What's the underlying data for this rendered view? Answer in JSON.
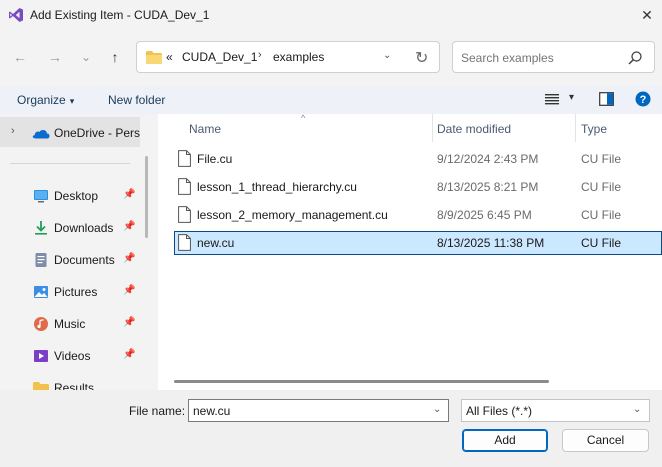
{
  "window": {
    "title": "Add Existing Item - CUDA_Dev_1",
    "close_glyph": "✕"
  },
  "nav": {
    "back_glyph": "←",
    "forward_glyph": "→",
    "recent_glyph": "⌄",
    "up_glyph": "↑"
  },
  "address": {
    "overflow": "«",
    "crumbs": [
      "CUDA_Dev_1",
      "examples"
    ],
    "separator": "›",
    "dropdown_glyph": "⌄",
    "refresh_glyph": "↻"
  },
  "search": {
    "placeholder": "Search examples"
  },
  "toolbar": {
    "organize_label": "Organize",
    "new_folder_label": "New folder",
    "caret": "▾"
  },
  "sidebar": {
    "onedrive_label": "OneDrive - Perso",
    "chevron": "›",
    "pin_glyph": "📌",
    "items": [
      {
        "label": "Desktop",
        "icon": "desktop-icon"
      },
      {
        "label": "Downloads",
        "icon": "downloads-icon"
      },
      {
        "label": "Documents",
        "icon": "documents-icon"
      },
      {
        "label": "Pictures",
        "icon": "pictures-icon"
      },
      {
        "label": "Music",
        "icon": "music-icon"
      },
      {
        "label": "Videos",
        "icon": "videos-icon"
      },
      {
        "label": "Results",
        "icon": "folder-icon"
      }
    ]
  },
  "columns": {
    "name": "Name",
    "date": "Date modified",
    "type": "Type",
    "sort_glyph": "^"
  },
  "files": [
    {
      "name": "File.cu",
      "date": "9/12/2024 2:43 PM",
      "type": "CU File",
      "selected": false
    },
    {
      "name": "lesson_1_thread_hierarchy.cu",
      "date": "8/13/2025 8:21 PM",
      "type": "CU File",
      "selected": false
    },
    {
      "name": "lesson_2_memory_management.cu",
      "date": "8/9/2025 6:45 PM",
      "type": "CU File",
      "selected": false
    },
    {
      "name": "new.cu",
      "date": "8/13/2025 11:38 PM",
      "type": "CU File",
      "selected": true
    }
  ],
  "footer": {
    "file_name_label": "File name:",
    "file_name_value": "new.cu",
    "dropdown_glyph": "⌄",
    "file_type": "All Files (*.*)",
    "add_label": "Add",
    "cancel_label": "Cancel"
  },
  "colors": {
    "accent": "#0067c0",
    "selection_bg": "#cce8ff",
    "selection_border": "#0a4a8a",
    "vs_purple": "#7a4cc2"
  }
}
